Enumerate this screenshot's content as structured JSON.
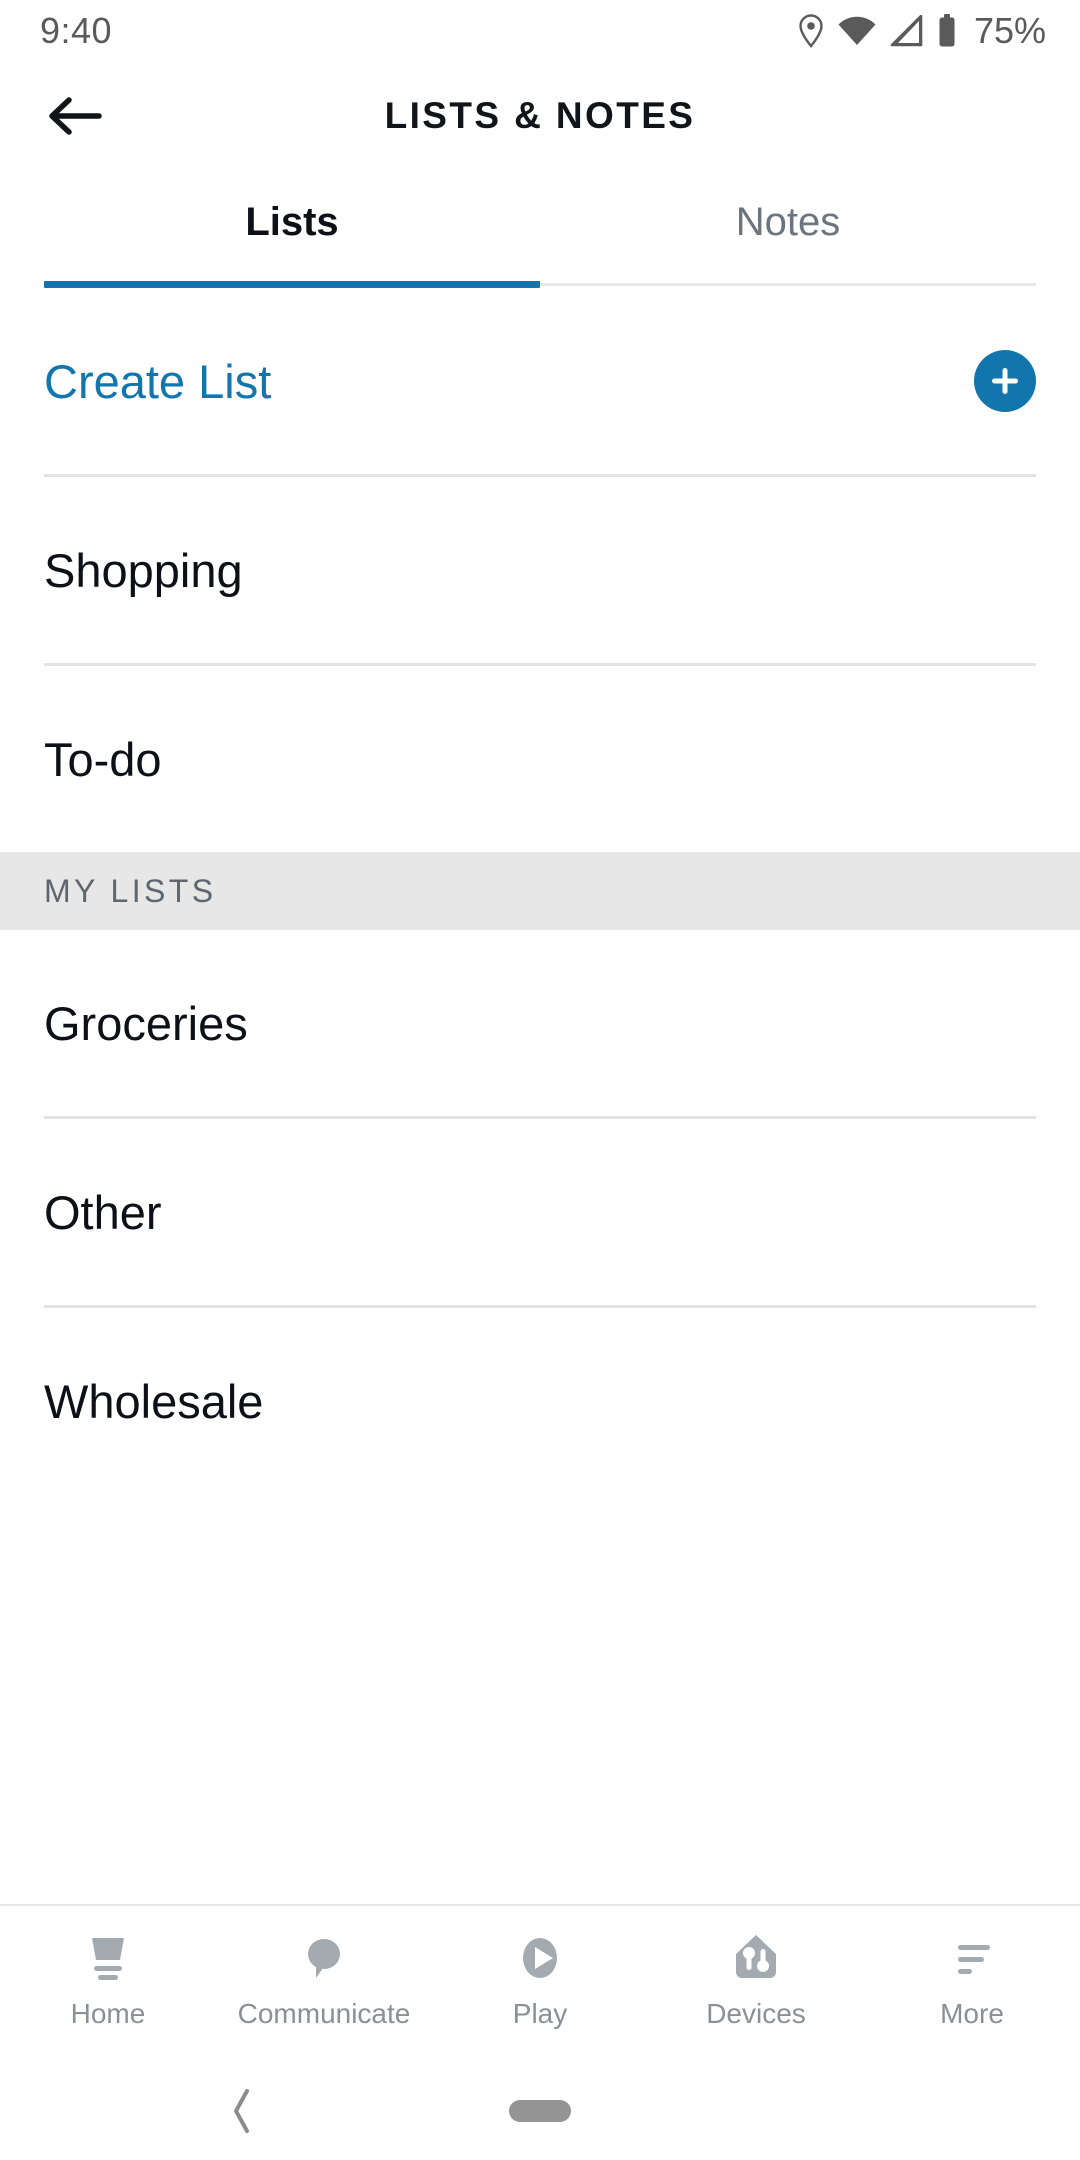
{
  "status_bar": {
    "time": "9:40",
    "battery_percent": "75%",
    "icons": [
      "location-pin-icon",
      "wifi-icon",
      "cellular-signal-icon",
      "battery-icon"
    ]
  },
  "header": {
    "title": "LISTS & NOTES",
    "back_icon": "back-arrow-icon"
  },
  "tabs": [
    {
      "label": "Lists",
      "active": true
    },
    {
      "label": "Notes",
      "active": false
    }
  ],
  "create_row": {
    "label": "Create List",
    "add_icon": "plus-icon"
  },
  "default_lists": [
    {
      "label": "Shopping"
    },
    {
      "label": "To-do"
    }
  ],
  "my_lists_section": {
    "header": "MY LISTS",
    "items": [
      {
        "label": "Groceries"
      },
      {
        "label": "Other"
      },
      {
        "label": "Wholesale"
      }
    ]
  },
  "bottom_nav": [
    {
      "label": "Home",
      "icon": "echo-show-device-icon"
    },
    {
      "label": "Communicate",
      "icon": "speech-bubble-icon"
    },
    {
      "label": "Play",
      "icon": "play-circle-icon"
    },
    {
      "label": "Devices",
      "icon": "smart-home-icon"
    },
    {
      "label": "More",
      "icon": "hamburger-menu-icon"
    }
  ],
  "android_nav": {
    "back_icon": "chevron-left-icon",
    "home_pill": "home-pill-indicator"
  },
  "colors": {
    "accent_blue": "#1276ac",
    "text_primary": "#0d1117",
    "text_muted": "#6c757d",
    "section_bg": "#e7e7e7",
    "nav_icon_gray": "#a3aab0",
    "status_gray": "#5a5a5a"
  }
}
